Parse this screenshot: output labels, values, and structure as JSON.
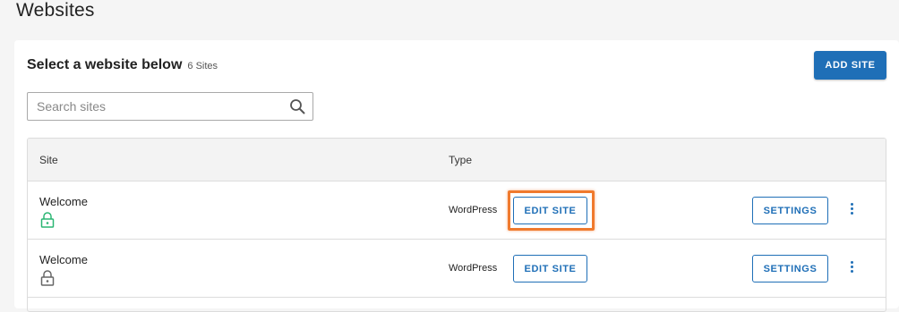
{
  "page": {
    "title": "Websites"
  },
  "card": {
    "heading": "Select a website below",
    "count": "6 Sites",
    "add_site_label": "ADD SITE"
  },
  "search": {
    "placeholder": "Search sites",
    "value": ""
  },
  "table": {
    "columns": [
      "Site",
      "Type"
    ],
    "rows": [
      {
        "site": "Welcome",
        "lock_status": "secure",
        "lock_color": "#2bb673",
        "type": "WordPress",
        "edit_label": "EDIT SITE",
        "settings_label": "SETTINGS",
        "highlighted": true
      },
      {
        "site": "Welcome",
        "lock_status": "not-secure",
        "lock_color": "#666666",
        "type": "WordPress",
        "edit_label": "EDIT SITE",
        "settings_label": "SETTINGS",
        "highlighted": false
      }
    ]
  },
  "colors": {
    "accent": "#1f6fb7",
    "highlight": "#f07a2e",
    "secure": "#2bb673"
  },
  "icons": [
    "search-icon",
    "lock-icon",
    "more-options-icon"
  ]
}
